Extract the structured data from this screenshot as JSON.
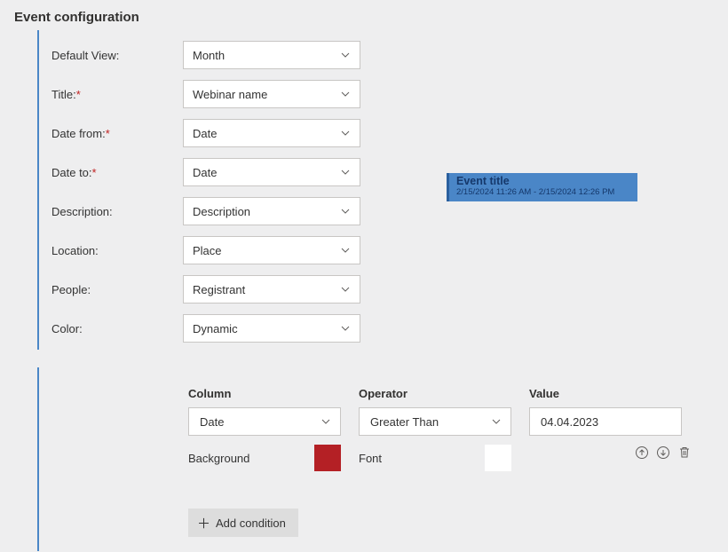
{
  "header": {
    "title": "Event configuration"
  },
  "fields": {
    "defaultView": {
      "label": "Default View:",
      "value": "Month",
      "required": false
    },
    "title": {
      "label": "Title:",
      "value": "Webinar name",
      "required": true
    },
    "dateFrom": {
      "label": "Date from:",
      "value": "Date",
      "required": true
    },
    "dateTo": {
      "label": "Date to:",
      "value": "Date",
      "required": true
    },
    "description": {
      "label": "Description:",
      "value": "Description",
      "required": false
    },
    "location": {
      "label": "Location:",
      "value": "Place",
      "required": false
    },
    "people": {
      "label": "People:",
      "value": "Registrant",
      "required": false
    },
    "color": {
      "label": "Color:",
      "value": "Dynamic",
      "required": false
    }
  },
  "preview": {
    "title": "Event title",
    "dateRange": "2/15/2024 11:26 AM - 2/15/2024 12:26 PM",
    "bg": "#4a86c7",
    "accent": "#2a5f9e"
  },
  "condition": {
    "headers": {
      "column": "Column",
      "operator": "Operator",
      "value": "Value"
    },
    "row": {
      "columnValue": "Date",
      "operatorValue": "Greater Than",
      "valueValue": "04.04.2023"
    },
    "colors": {
      "bgLabel": "Background",
      "bgColor": "#b42025",
      "fontLabel": "Font",
      "fontColor": "#ffffff"
    },
    "addLabel": "Add condition"
  }
}
